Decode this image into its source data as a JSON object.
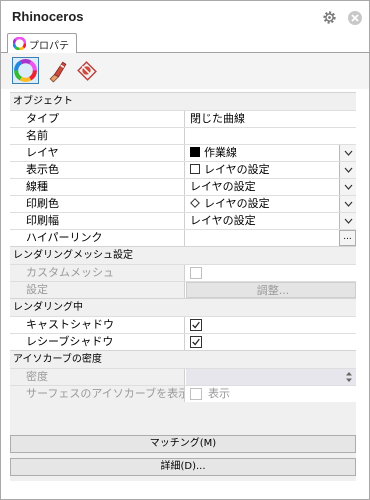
{
  "window": {
    "title": "Rhinoceros"
  },
  "tab": {
    "label": "プロパティ"
  },
  "toolbar": {
    "buttons": [
      "object-properties",
      "material",
      "decal"
    ]
  },
  "sections": {
    "object": "オブジェクト",
    "render_mesh": "レンダリングメッシュ設定",
    "rendering": "レンダリング中",
    "isocurve": "アイソカーブの密度"
  },
  "object": {
    "type_label": "タイプ",
    "type_value": "閉じた曲線",
    "name_label": "名前",
    "name_value": "",
    "layer_label": "レイヤ",
    "layer_value": "作業線",
    "display_color_label": "表示色",
    "display_color_value": "レイヤの設定",
    "linetype_label": "線種",
    "linetype_value": "レイヤの設定",
    "print_color_label": "印刷色",
    "print_color_value": "レイヤの設定",
    "print_width_label": "印刷幅",
    "print_width_value": "レイヤの設定",
    "hyperlink_label": "ハイパーリンク",
    "hyperlink_value": "",
    "hyperlink_button": "..."
  },
  "render_mesh": {
    "custom_mesh_label": "カスタムメッシュ",
    "settings_label": "設定",
    "adjust_button": "調整..."
  },
  "rendering": {
    "casts_shadows_label": "キャストシャドウ",
    "casts_shadows": true,
    "receives_shadows_label": "レシーブシャドウ",
    "receives_shadows": true
  },
  "isocurve": {
    "density_label": "密度",
    "show_surface_isocurves_label": "サーフェスのアイソカーブを表示",
    "show_label": "表示"
  },
  "buttons": {
    "match": "マッチング(M)",
    "details": "詳細(D)..."
  },
  "colors": {
    "layer_swatch": "#000000",
    "accent": "#3c7fb1"
  }
}
